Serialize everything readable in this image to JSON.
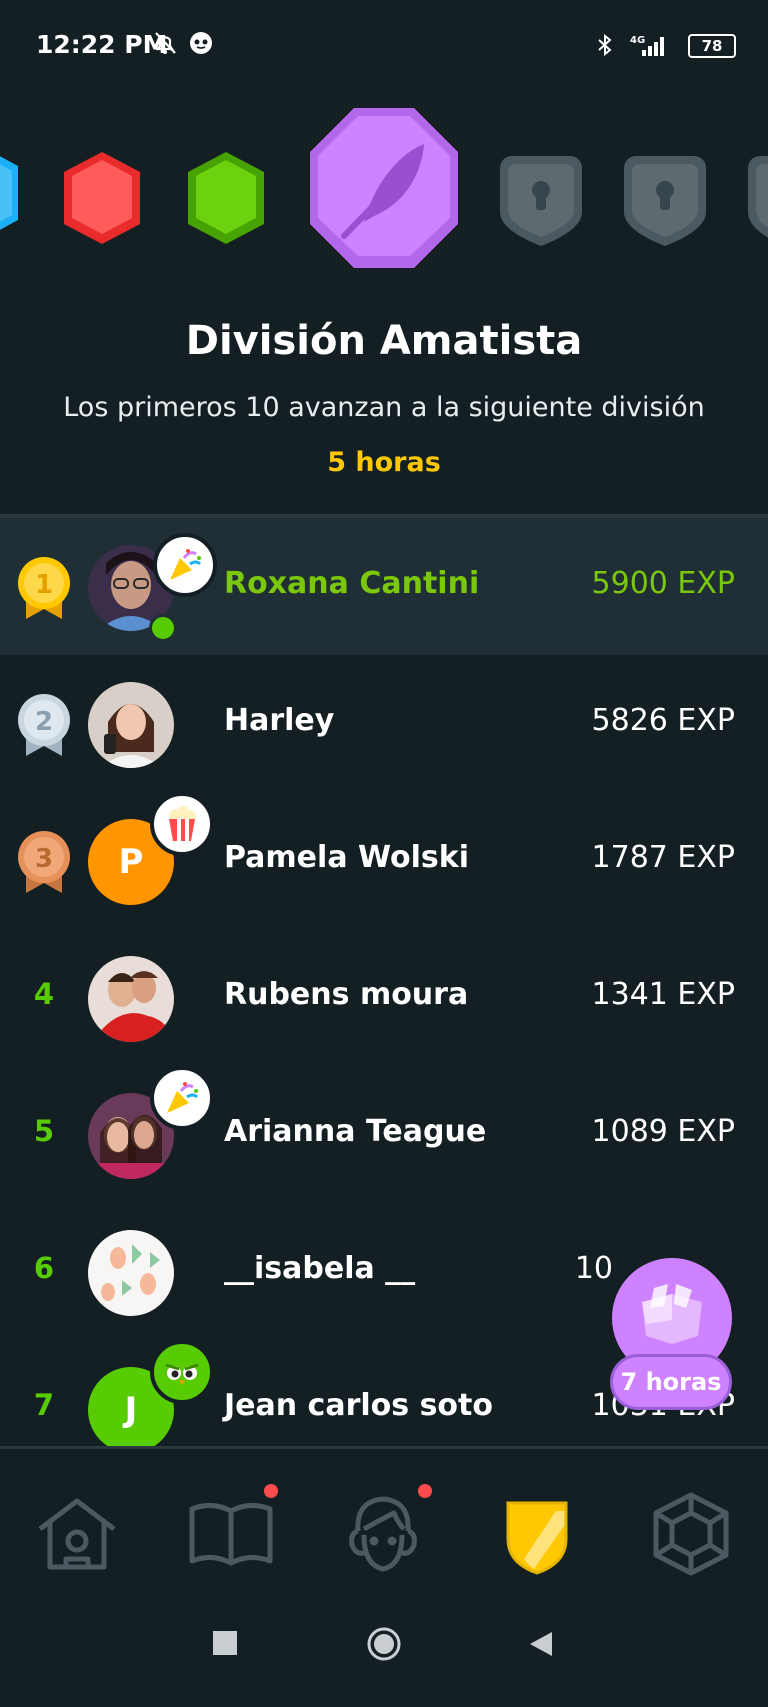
{
  "status_bar": {
    "time": "12:22 PM",
    "network": "4G",
    "battery": "78",
    "icons_left": [
      "mute-bell-icon",
      "app-notification-icon"
    ],
    "icons_right": [
      "bluetooth-icon",
      "signal-icon",
      "battery-icon"
    ]
  },
  "badges": [
    {
      "name": "blue-league-badge",
      "color": "#1cb0f6",
      "state": "past"
    },
    {
      "name": "red-league-badge",
      "color": "#ff4b4b",
      "state": "past"
    },
    {
      "name": "green-league-badge",
      "color": "#58cc02",
      "state": "past"
    },
    {
      "name": "amethyst-league-badge",
      "color": "#ce82ff",
      "state": "current"
    },
    {
      "name": "locked-league-badge",
      "color": "#4b5a60",
      "state": "locked"
    },
    {
      "name": "locked-league-badge",
      "color": "#4b5a60",
      "state": "locked"
    },
    {
      "name": "locked-league-badge",
      "color": "#4b5a60",
      "state": "locked"
    }
  ],
  "division": {
    "title": "División Amatista",
    "subtitle": "Los primeros 10 avanzan a la siguiente división",
    "time_left": "5 horas"
  },
  "leaderboard": [
    {
      "rank": "1",
      "name": "Roxana Cantini",
      "xp": "5900 EXP",
      "medal": "gold",
      "avatar": "photo",
      "badge": "party-popper-icon",
      "online": true,
      "current": true
    },
    {
      "rank": "2",
      "name": "Harley",
      "xp": "5826 EXP",
      "medal": "silver",
      "avatar": "photo"
    },
    {
      "rank": "3",
      "name": "Pamela Wolski",
      "xp": "1787 EXP",
      "medal": "bronze",
      "avatar": "letter",
      "letter": "P",
      "avatar_color": "#ff9600",
      "badge": "popcorn-icon"
    },
    {
      "rank": "4",
      "name": "Rubens moura",
      "xp": "1341 EXP",
      "avatar": "photo"
    },
    {
      "rank": "5",
      "name": "Arianna Teague",
      "xp": "1089 EXP",
      "avatar": "photo",
      "badge": "party-popper-icon"
    },
    {
      "rank": "6",
      "name": "__isabela __",
      "xp": "10",
      "avatar": "photo"
    },
    {
      "rank": "7",
      "name": "Jean carlos soto",
      "xp": "1031 EXP",
      "avatar": "letter",
      "letter": "J",
      "avatar_color": "#58cc02",
      "badge": "angry-owl-icon"
    }
  ],
  "floating_chest": {
    "label": "7 horas",
    "color": "#ce82ff"
  },
  "tabs": [
    {
      "name": "tab-home",
      "icon": "home-icon",
      "active": false,
      "notification": false
    },
    {
      "name": "tab-stories",
      "icon": "book-icon",
      "active": false,
      "notification": true
    },
    {
      "name": "tab-profile",
      "icon": "face-icon",
      "active": false,
      "notification": true
    },
    {
      "name": "tab-leaderboard",
      "icon": "shield-icon",
      "active": true,
      "notification": false
    },
    {
      "name": "tab-shop",
      "icon": "gem-icon",
      "active": false,
      "notification": false
    }
  ],
  "colors": {
    "background": "#141f23",
    "accent_green": "#58cc02",
    "highlight_row": "#202f36",
    "gold_text": "#ffc800"
  }
}
